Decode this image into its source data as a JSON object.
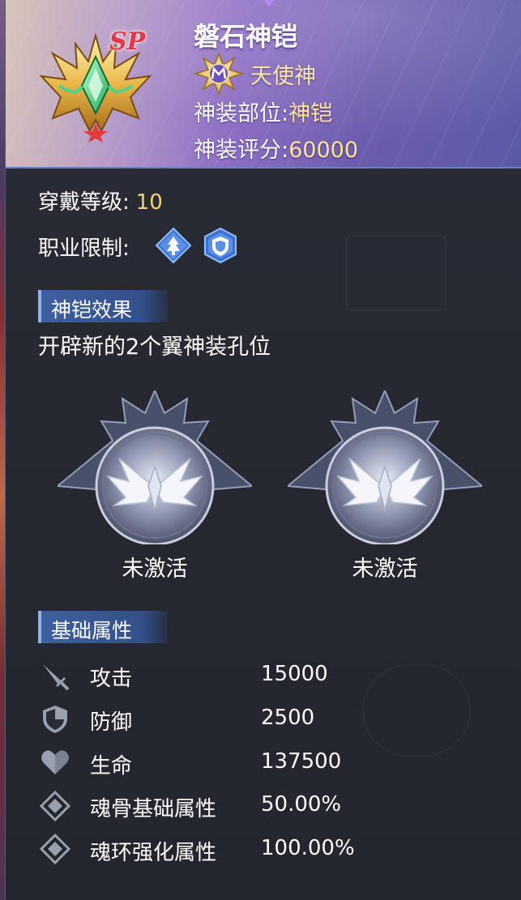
{
  "item": {
    "name": "磐石神铠",
    "sp_badge": "SP",
    "god_type": "天使神",
    "slot_label": "神装部位:",
    "slot_value": "神铠",
    "score_label": "神装评分:",
    "score_value": "60000"
  },
  "requirements": {
    "level_label": "穿戴等级:",
    "level_value": "10",
    "class_label": "职业限制:",
    "class_icons": [
      "attack-class-icon",
      "defense-class-icon"
    ]
  },
  "effect": {
    "section_title": "神铠效果",
    "description": "开辟新的2个翼神装孔位",
    "sockets": [
      {
        "icon": "wing-socket-icon",
        "status": "未激活"
      },
      {
        "icon": "wing-socket-icon",
        "status": "未激活"
      }
    ]
  },
  "attributes": {
    "section_title": "基础属性",
    "rows": [
      {
        "icon": "sword-icon",
        "name": "攻击",
        "value": "15000"
      },
      {
        "icon": "shield-icon",
        "name": "防御",
        "value": "2500"
      },
      {
        "icon": "heart-icon",
        "name": "生命",
        "value": "137500"
      },
      {
        "icon": "diamond-icon",
        "name": "魂骨基础属性",
        "value": "50.00%"
      },
      {
        "icon": "diamond-icon",
        "name": "魂环强化属性",
        "value": "100.00%"
      }
    ]
  },
  "colors": {
    "gold_value": "#f3d272",
    "section_tag": "#3f5f9e",
    "panel_bg": "#262932"
  }
}
